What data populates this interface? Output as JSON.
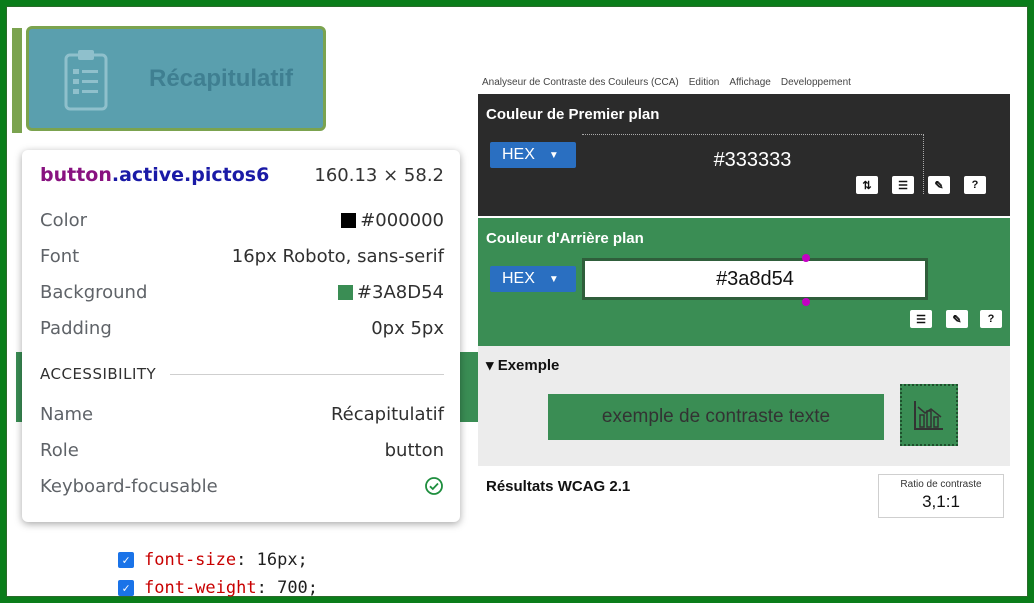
{
  "page": {
    "border_color": "#0a7d1a"
  },
  "recap_button": {
    "label": "Récapitulatif",
    "bg": "#5a9fae",
    "icon": "clipboard-list-icon"
  },
  "tooltip": {
    "tag": "button",
    "cls": ".active.pictos6",
    "size": "160.13 × 58.2",
    "rows": [
      {
        "key": "Color",
        "value": "#000000",
        "swatch": "#000000"
      },
      {
        "key": "Font",
        "value": "16px Roboto, sans-serif"
      },
      {
        "key": "Background",
        "value": "#3A8D54",
        "swatch": "#3A8D54"
      },
      {
        "key": "Padding",
        "value": "0px 5px"
      }
    ],
    "section": "ACCESSIBILITY",
    "a11y": [
      {
        "key": "Name",
        "value": "Récapitulatif"
      },
      {
        "key": "Role",
        "value": "button"
      },
      {
        "key": "Keyboard-focusable",
        "icon": "check-circle-icon"
      }
    ]
  },
  "css": [
    {
      "prop": "font-size",
      "value": "16px;"
    },
    {
      "prop": "font-weight",
      "value": "700;"
    }
  ],
  "cca": {
    "menu": [
      "Analyseur de Contraste des Couleurs (CCA)",
      "Edition",
      "Affichage",
      "Developpement"
    ],
    "foreground": {
      "title": "Couleur de Premier plan",
      "format": "HEX",
      "value": "#333333"
    },
    "background": {
      "title": "Couleur d'Arrière plan",
      "format": "HEX",
      "value": "#3a8d54"
    },
    "example": {
      "title": "Exemple",
      "text": "exemple de contraste texte"
    },
    "results": {
      "title": "Résultats WCAG 2.1",
      "ratio_label": "Ratio de contraste",
      "ratio_value": "3,1:1"
    },
    "colors": {
      "fg": "#333333",
      "bg": "#3a8d54"
    }
  }
}
